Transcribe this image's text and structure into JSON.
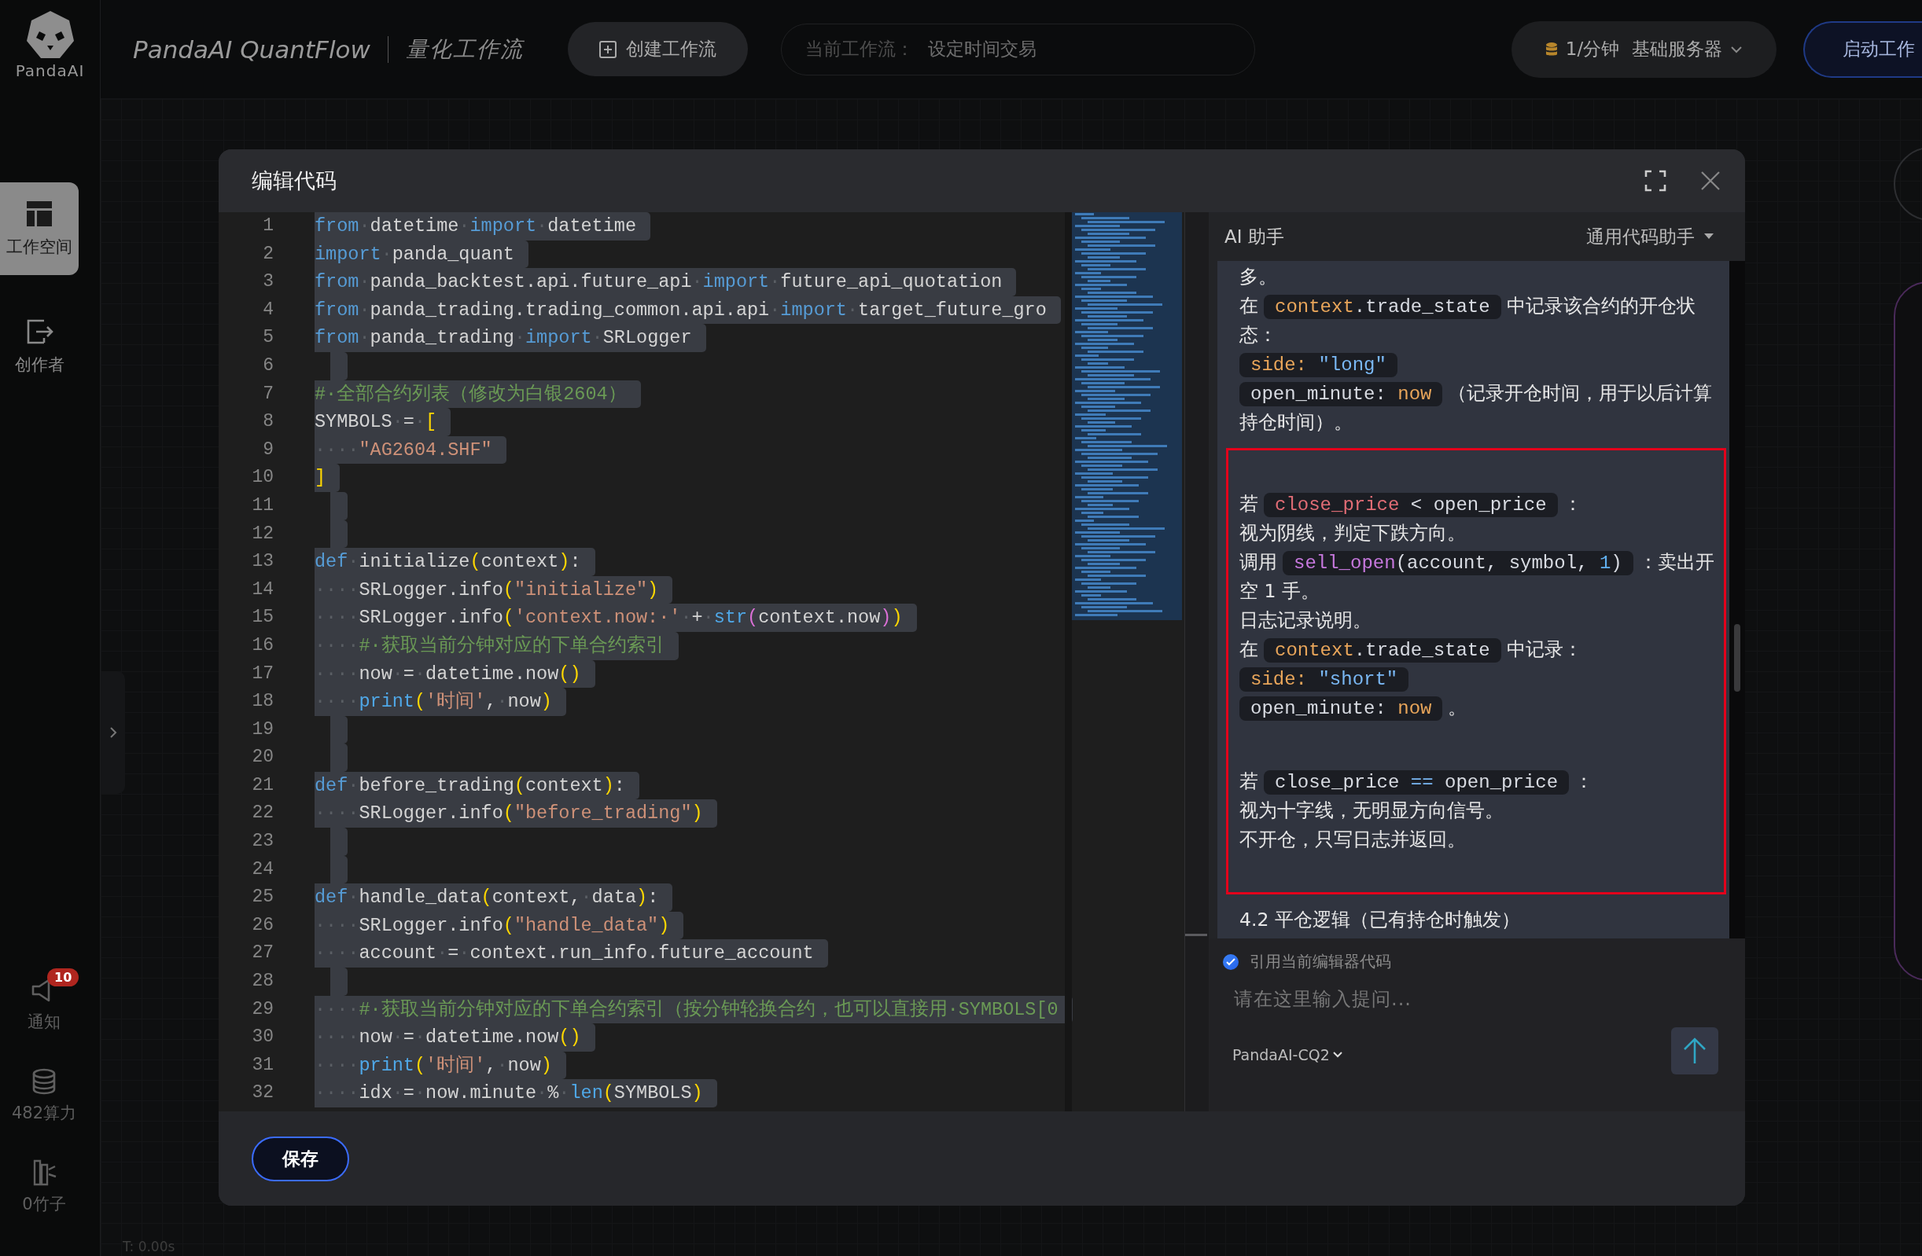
{
  "sidebar": {
    "logo_text": "PandaAI",
    "items": [
      {
        "label": "工作空间",
        "selected": true
      },
      {
        "label": "创作者",
        "selected": false
      }
    ],
    "bottom_items": [
      {
        "label": "通知",
        "badge": "10"
      },
      {
        "label": "482算力"
      },
      {
        "label": "0竹子"
      }
    ]
  },
  "topbar": {
    "brand": "PandaAI QuantFlow",
    "subtitle": "量化工作流",
    "create_button": "创建工作流",
    "workflow_field": {
      "label": "当前工作流：",
      "value": "设定时间交易"
    },
    "server": {
      "rate": "1/分钟",
      "name": "基础服务器"
    },
    "launch_button": "启动工作"
  },
  "canvas": {
    "timer": "T: 0.00s"
  },
  "dialog": {
    "title": "编辑代码",
    "editor": {
      "all_selected": true,
      "lines": [
        {
          "n": "1",
          "seg": [
            {
              "kind": "k",
              "text": "from"
            },
            {
              "kind": "w",
              "text": "·"
            },
            {
              "kind": "p",
              "text": "datetime"
            },
            {
              "kind": "w",
              "text": "·"
            },
            {
              "kind": "k",
              "text": "import"
            },
            {
              "kind": "w",
              "text": "·"
            },
            {
              "kind": "p",
              "text": "datetime"
            }
          ]
        },
        {
          "n": "2",
          "seg": [
            {
              "kind": "k",
              "text": "import"
            },
            {
              "kind": "w",
              "text": "·"
            },
            {
              "kind": "p",
              "text": "panda_quant"
            }
          ]
        },
        {
          "n": "3",
          "seg": [
            {
              "kind": "k",
              "text": "from"
            },
            {
              "kind": "w",
              "text": "·"
            },
            {
              "kind": "p",
              "text": "panda_backtest.api.future_api"
            },
            {
              "kind": "w",
              "text": "·"
            },
            {
              "kind": "k",
              "text": "import"
            },
            {
              "kind": "w",
              "text": "·"
            },
            {
              "kind": "p",
              "text": "future_api_quotation"
            }
          ]
        },
        {
          "n": "4",
          "seg": [
            {
              "kind": "k",
              "text": "from"
            },
            {
              "kind": "w",
              "text": "·"
            },
            {
              "kind": "p",
              "text": "panda_trading.trading_common.api.api"
            },
            {
              "kind": "w",
              "text": "·"
            },
            {
              "kind": "k",
              "text": "import"
            },
            {
              "kind": "w",
              "text": "·"
            },
            {
              "kind": "p",
              "text": "target_future_gro"
            }
          ]
        },
        {
          "n": "5",
          "seg": [
            {
              "kind": "k",
              "text": "from"
            },
            {
              "kind": "w",
              "text": "·"
            },
            {
              "kind": "p",
              "text": "panda_trading"
            },
            {
              "kind": "w",
              "text": "·"
            },
            {
              "kind": "k",
              "text": "import"
            },
            {
              "kind": "w",
              "text": "·"
            },
            {
              "kind": "p",
              "text": "SRLogger"
            }
          ]
        },
        {
          "n": "6"
        },
        {
          "n": "7",
          "seg": [
            {
              "kind": "c",
              "text": "#·全部合约列表（修改为白银2604）"
            }
          ]
        },
        {
          "n": "8",
          "seg": [
            {
              "kind": "p",
              "text": "SYMBOLS"
            },
            {
              "kind": "w",
              "text": "·"
            },
            {
              "kind": "p",
              "text": "="
            },
            {
              "kind": "w",
              "text": "·"
            },
            {
              "kind": "b",
              "text": "["
            }
          ]
        },
        {
          "n": "9",
          "seg": [
            {
              "kind": "w",
              "text": "····"
            },
            {
              "kind": "s",
              "text": "\"AG2604.SHF\""
            }
          ]
        },
        {
          "n": "10",
          "seg": [
            {
              "kind": "b",
              "text": "]"
            }
          ]
        },
        {
          "n": "11"
        },
        {
          "n": "12"
        },
        {
          "n": "13",
          "seg": [
            {
              "kind": "k",
              "text": "def"
            },
            {
              "kind": "w",
              "text": "·"
            },
            {
              "kind": "p",
              "text": "initialize"
            },
            {
              "kind": "b",
              "text": "("
            },
            {
              "kind": "p",
              "text": "context"
            },
            {
              "kind": "b",
              "text": ")"
            },
            {
              "kind": "p",
              "text": ":"
            }
          ]
        },
        {
          "n": "14",
          "seg": [
            {
              "kind": "w",
              "text": "····"
            },
            {
              "kind": "p",
              "text": "SRLogger.info"
            },
            {
              "kind": "b",
              "text": "("
            },
            {
              "kind": "s",
              "text": "\"initialize\""
            },
            {
              "kind": "b",
              "text": ")"
            }
          ]
        },
        {
          "n": "15",
          "seg": [
            {
              "kind": "w",
              "text": "····"
            },
            {
              "kind": "p",
              "text": "SRLogger.info"
            },
            {
              "kind": "b",
              "text": "("
            },
            {
              "kind": "s",
              "text": "'context.now:·'"
            },
            {
              "kind": "w",
              "text": "·"
            },
            {
              "kind": "p",
              "text": "+"
            },
            {
              "kind": "w",
              "text": "·"
            },
            {
              "kind": "f",
              "text": "str"
            },
            {
              "kind": "m",
              "text": "("
            },
            {
              "kind": "p",
              "text": "context.now"
            },
            {
              "kind": "m",
              "text": ")"
            },
            {
              "kind": "b",
              "text": ")"
            }
          ]
        },
        {
          "n": "16",
          "seg": [
            {
              "kind": "w",
              "text": "····"
            },
            {
              "kind": "c",
              "text": "#·获取当前分钟对应的下单合约索引"
            }
          ]
        },
        {
          "n": "17",
          "seg": [
            {
              "kind": "w",
              "text": "····"
            },
            {
              "kind": "p",
              "text": "now"
            },
            {
              "kind": "w",
              "text": "·"
            },
            {
              "kind": "p",
              "text": "="
            },
            {
              "kind": "w",
              "text": "·"
            },
            {
              "kind": "p",
              "text": "datetime.now"
            },
            {
              "kind": "b",
              "text": "()"
            }
          ]
        },
        {
          "n": "18",
          "seg": [
            {
              "kind": "w",
              "text": "····"
            },
            {
              "kind": "f",
              "text": "print"
            },
            {
              "kind": "b",
              "text": "("
            },
            {
              "kind": "s",
              "text": "'时间'"
            },
            {
              "kind": "p",
              "text": ","
            },
            {
              "kind": "w",
              "text": "·"
            },
            {
              "kind": "p",
              "text": "now"
            },
            {
              "kind": "b",
              "text": ")"
            }
          ]
        },
        {
          "n": "19"
        },
        {
          "n": "20"
        },
        {
          "n": "21",
          "seg": [
            {
              "kind": "k",
              "text": "def"
            },
            {
              "kind": "w",
              "text": "·"
            },
            {
              "kind": "p",
              "text": "before_trading"
            },
            {
              "kind": "b",
              "text": "("
            },
            {
              "kind": "p",
              "text": "context"
            },
            {
              "kind": "b",
              "text": ")"
            },
            {
              "kind": "p",
              "text": ":"
            }
          ]
        },
        {
          "n": "22",
          "seg": [
            {
              "kind": "w",
              "text": "····"
            },
            {
              "kind": "p",
              "text": "SRLogger.info"
            },
            {
              "kind": "b",
              "text": "("
            },
            {
              "kind": "s",
              "text": "\"before_trading\""
            },
            {
              "kind": "b",
              "text": ")"
            }
          ]
        },
        {
          "n": "23"
        },
        {
          "n": "24"
        },
        {
          "n": "25",
          "seg": [
            {
              "kind": "k",
              "text": "def"
            },
            {
              "kind": "w",
              "text": "·"
            },
            {
              "kind": "p",
              "text": "handle_data"
            },
            {
              "kind": "b",
              "text": "("
            },
            {
              "kind": "p",
              "text": "context,"
            },
            {
              "kind": "w",
              "text": "·"
            },
            {
              "kind": "p",
              "text": "data"
            },
            {
              "kind": "b",
              "text": ")"
            },
            {
              "kind": "p",
              "text": ":"
            }
          ]
        },
        {
          "n": "26",
          "seg": [
            {
              "kind": "w",
              "text": "····"
            },
            {
              "kind": "p",
              "text": "SRLogger.info"
            },
            {
              "kind": "b",
              "text": "("
            },
            {
              "kind": "s",
              "text": "\"handle_data\""
            },
            {
              "kind": "b",
              "text": ")"
            }
          ]
        },
        {
          "n": "27",
          "seg": [
            {
              "kind": "w",
              "text": "····"
            },
            {
              "kind": "p",
              "text": "account"
            },
            {
              "kind": "w",
              "text": "·"
            },
            {
              "kind": "p",
              "text": "="
            },
            {
              "kind": "w",
              "text": "·"
            },
            {
              "kind": "p",
              "text": "context.run_info.future_account"
            }
          ]
        },
        {
          "n": "28"
        },
        {
          "n": "29",
          "seg": [
            {
              "kind": "w",
              "text": "····"
            },
            {
              "kind": "c",
              "text": "#·获取当前分钟对应的下单合约索引（按分钟轮换合约，也可以直接用·SYMBOLS[0"
            }
          ]
        },
        {
          "n": "30",
          "seg": [
            {
              "kind": "w",
              "text": "····"
            },
            {
              "kind": "p",
              "text": "now"
            },
            {
              "kind": "w",
              "text": "·"
            },
            {
              "kind": "p",
              "text": "="
            },
            {
              "kind": "w",
              "text": "·"
            },
            {
              "kind": "p",
              "text": "datetime.now"
            },
            {
              "kind": "b",
              "text": "()"
            }
          ]
        },
        {
          "n": "31",
          "seg": [
            {
              "kind": "w",
              "text": "····"
            },
            {
              "kind": "f",
              "text": "print"
            },
            {
              "kind": "b",
              "text": "("
            },
            {
              "kind": "s",
              "text": "'时间'"
            },
            {
              "kind": "p",
              "text": ","
            },
            {
              "kind": "w",
              "text": "·"
            },
            {
              "kind": "p",
              "text": "now"
            },
            {
              "kind": "b",
              "text": ")"
            }
          ]
        },
        {
          "n": "32",
          "seg": [
            {
              "kind": "w",
              "text": "····"
            },
            {
              "kind": "p",
              "text": "idx"
            },
            {
              "kind": "w",
              "text": "·"
            },
            {
              "kind": "p",
              "text": "="
            },
            {
              "kind": "w",
              "text": "·"
            },
            {
              "kind": "p",
              "text": "now.minute"
            },
            {
              "kind": "w",
              "text": "·"
            },
            {
              "kind": "p",
              "text": "%"
            },
            {
              "kind": "w",
              "text": "·"
            },
            {
              "kind": "f",
              "text": "len"
            },
            {
              "kind": "b",
              "text": "("
            },
            {
              "kind": "p",
              "text": "SYMBOLS"
            },
            {
              "kind": "b",
              "text": ")"
            }
          ]
        }
      ]
    },
    "assistant": {
      "title": "AI 助手",
      "mode": "通用代码助手",
      "sections": [
        {
          "outlined": false,
          "paragraphs": [
            [
              [
                {
                  "kind": "text",
                  "text": "多。"
                }
              ],
              [
                {
                  "kind": "text",
                  "text": "在"
                },
                {
                  "kind": "code",
                  "parts": [
                    {
                      "kind": "o",
                      "text": "context"
                    },
                    {
                      "kind": "p",
                      "text": ".trade_state"
                    }
                  ]
                },
                {
                  "kind": "text",
                  "text": "中记录该合约的开仓状态："
                }
              ],
              [
                {
                  "kind": "code",
                  "parts": [
                    {
                      "kind": "o",
                      "text": "side: "
                    },
                    {
                      "kind": "l",
                      "text": "\"long\""
                    }
                  ]
                }
              ],
              [
                {
                  "kind": "code",
                  "parts": [
                    {
                      "kind": "p",
                      "text": "open_minute: "
                    },
                    {
                      "kind": "o",
                      "text": "now"
                    }
                  ]
                },
                {
                  "kind": "text",
                  "text": "（记录开仓时间，用于以后计算持仓时间）。"
                }
              ]
            ]
          ]
        },
        {
          "outlined": true,
          "paragraphs": [
            [
              [
                {
                  "kind": "text",
                  "text": "若"
                },
                {
                  "kind": "code",
                  "parts": [
                    {
                      "kind": "r",
                      "text": "close_price"
                    },
                    {
                      "kind": "p",
                      "text": " < open_price"
                    }
                  ]
                },
                {
                  "kind": "text",
                  "text": "："
                }
              ],
              [
                {
                  "kind": "text",
                  "text": "视为阴线，判定下跌方向。"
                }
              ],
              [
                {
                  "kind": "text",
                  "text": "调用"
                },
                {
                  "kind": "code",
                  "parts": [
                    {
                      "kind": "v",
                      "text": "sell_open"
                    },
                    {
                      "kind": "p",
                      "text": "(account, symbol, "
                    },
                    {
                      "kind": "n",
                      "text": "1"
                    },
                    {
                      "kind": "p",
                      "text": ")"
                    }
                  ]
                },
                {
                  "kind": "text",
                  "text": "：卖出开空 1 手。"
                }
              ],
              [
                {
                  "kind": "text",
                  "text": "日志记录说明。"
                }
              ],
              [
                {
                  "kind": "text",
                  "text": "在"
                },
                {
                  "kind": "code",
                  "parts": [
                    {
                      "kind": "o",
                      "text": "context"
                    },
                    {
                      "kind": "p",
                      "text": ".trade_state"
                    }
                  ]
                },
                {
                  "kind": "text",
                  "text": "中记录："
                }
              ],
              [
                {
                  "kind": "code",
                  "parts": [
                    {
                      "kind": "o",
                      "text": "side: "
                    },
                    {
                      "kind": "l",
                      "text": "\"short\""
                    }
                  ]
                }
              ],
              [
                {
                  "kind": "code",
                  "parts": [
                    {
                      "kind": "p",
                      "text": "open_minute: "
                    },
                    {
                      "kind": "o",
                      "text": "now"
                    }
                  ]
                },
                {
                  "kind": "text",
                  "text": "。"
                }
              ]
            ],
            [
              [
                {
                  "kind": "text",
                  "text": "若"
                },
                {
                  "kind": "code",
                  "parts": [
                    {
                      "kind": "p",
                      "text": "close_price "
                    },
                    {
                      "kind": "l",
                      "text": "=="
                    },
                    {
                      "kind": "p",
                      "text": " open_price"
                    }
                  ]
                },
                {
                  "kind": "text",
                  "text": "："
                }
              ],
              [
                {
                  "kind": "text",
                  "text": "视为十字线，无明显方向信号。"
                }
              ],
              [
                {
                  "kind": "text",
                  "text": "不开仓，只写日志并返回。"
                }
              ]
            ]
          ]
        },
        {
          "outlined": false,
          "paragraphs": [
            [
              [
                {
                  "kind": "text",
                  "text": "4.2 平仓逻辑（已有持仓时触发）"
                }
              ]
            ]
          ]
        }
      ],
      "quote_code": {
        "label": "引用当前编辑器代码",
        "checked": true
      },
      "input": {
        "placeholder": "请在这里输入提问..."
      },
      "model": "PandaAI-CQ2"
    },
    "save_button": "保存"
  }
}
